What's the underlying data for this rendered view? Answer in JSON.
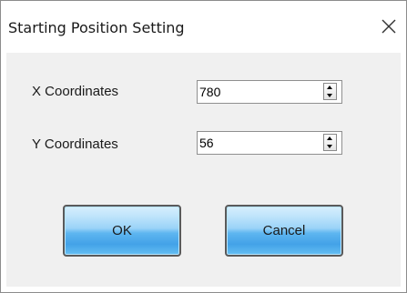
{
  "window": {
    "title": "Starting Position Setting",
    "close_glyph": "close-icon"
  },
  "fields": {
    "x": {
      "label": "X Coordinates",
      "value": "780"
    },
    "y": {
      "label": "Y Coordinates",
      "value": "56"
    }
  },
  "buttons": {
    "ok": "OK",
    "cancel": "Cancel"
  },
  "colors": {
    "button_gradient_top": "#d7effd",
    "button_gradient_bottom": "#43a2e8",
    "content_background": "#f0f0f0"
  }
}
